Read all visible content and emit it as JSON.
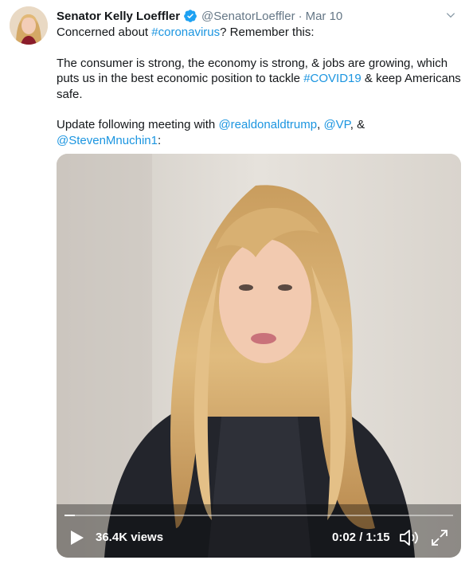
{
  "tweet": {
    "author_name": "Senator Kelly Loeffler",
    "handle": "@SenatorLoeffler",
    "separator": "·",
    "date": "Mar 10",
    "verified_icon": "verified-badge-icon",
    "text": {
      "line1_prefix": "Concerned about ",
      "line1_hashtag": "#coronavirus",
      "line1_suffix": "? Remember this:",
      "para2_prefix": "The consumer is strong, the economy is strong, & jobs are growing, which puts us in the best economic position to tackle ",
      "para2_hashtag": "#COVID19",
      "para2_suffix": " & keep Americans safe.",
      "para3_prefix": "Update following meeting with ",
      "mention1": "@realdonaldtrump",
      "comma1": ", ",
      "mention2": "@VP",
      "and": ", & ",
      "mention3": "@StevenMnuchin1",
      "colon": ":"
    }
  },
  "video": {
    "views": "36.4K views",
    "timecode": "0:02 / 1:15",
    "progress_fraction": 0.027,
    "icons": [
      "play-icon",
      "volume-icon",
      "fullscreen-icon"
    ]
  },
  "colors": {
    "link": "#1b95e0",
    "verified": "#1da1f2",
    "muted": "#657786"
  }
}
